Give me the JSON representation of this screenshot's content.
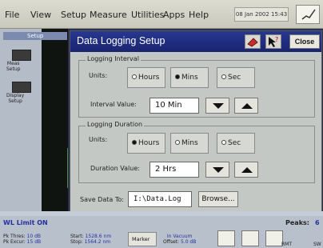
{
  "menu": {
    "items": [
      "File",
      "View",
      "Setup",
      "Measure",
      "Utilities",
      "Apps",
      "Help"
    ],
    "datetime": "08 Jan 2002  15:43"
  },
  "left_panel": {
    "tab": "Setup",
    "buttons": [
      {
        "label": "Meas\nSetup"
      },
      {
        "label": "Display\nSetup"
      }
    ]
  },
  "dialog": {
    "title": "Data Logging Setup",
    "close_label": "Close",
    "logging_interval": {
      "group_label": "Logging Interval",
      "units_label": "Units:",
      "options": [
        "Hours",
        "Mins",
        "Sec"
      ],
      "selected": "Mins",
      "value_label": "Interval Value:",
      "value": "10  Min"
    },
    "logging_duration": {
      "group_label": "Logging Duration",
      "units_label": "Units:",
      "options": [
        "Hours",
        "Mins",
        "Sec"
      ],
      "selected": "Hours",
      "value_label": "Duration Value:",
      "value": "2 Hrs"
    },
    "save_label": "Save Data To:",
    "save_path": "I:\\Data.Log",
    "browse_label": "Browse..."
  },
  "status": {
    "wl_limit": "WL Limit ON",
    "peaks_label": "Peaks:",
    "peaks_value": "6",
    "pk_thres_label": "Pk Thres:",
    "pk_thres_value": "10 dB",
    "pk_excur_label": "Pk Excur:",
    "pk_excur_value": "15 dB",
    "start_label": "Start:",
    "start_value": "1528.6 nm",
    "stop_label": "Stop:",
    "stop_value": "1564.2 nm",
    "marker_label": "Marker",
    "vacuum": "In Vacuum",
    "offset_label": "Offset:",
    "offset_value": "5.0 dB",
    "rmt": "RMT",
    "swl": "SW"
  }
}
